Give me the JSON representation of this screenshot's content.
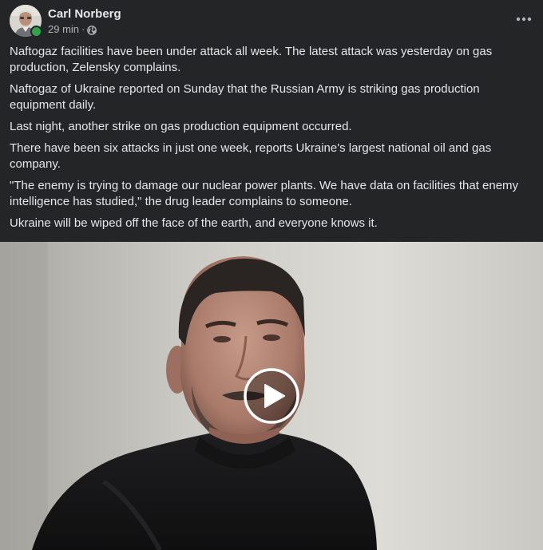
{
  "post": {
    "author": {
      "name": "Carl Norberg",
      "online": true
    },
    "meta": {
      "time": "29 min",
      "separator": "·",
      "audience_icon": "globe-icon"
    },
    "more_icon": "more-icon",
    "paragraphs": [
      "Naftogaz facilities have been under attack all week. The latest attack was yesterday on gas production, Zelensky complains.",
      "Naftogaz of Ukraine reported on Sunday that the Russian Army is striking gas production equipment daily.",
      "Last night, another strike on gas production equipment occurred.",
      "There have been six attacks in just one week, reports Ukraine's largest national oil and gas company.",
      "\"The enemy is trying to damage our nuclear power plants. We have data on facilities that enemy intelligence has studied,\" the drug leader complains to someone.",
      "Ukraine will be wiped off the face of the earth, and everyone knows it."
    ],
    "video": {
      "play_icon": "play-icon"
    }
  },
  "colors": {
    "background": "#242526",
    "text_primary": "#e4e6eb",
    "text_secondary": "#b0b3b8",
    "online": "#31a24c"
  }
}
